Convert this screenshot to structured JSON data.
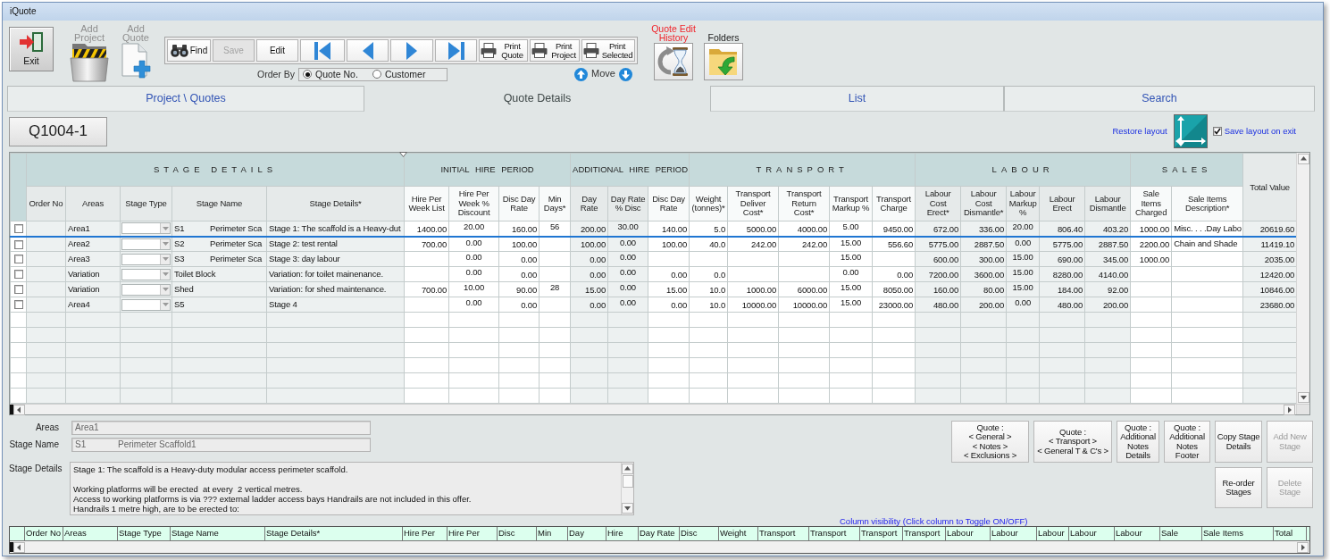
{
  "window": {
    "title": "iQuote"
  },
  "toolbar": {
    "exit": {
      "label": "Exit"
    },
    "add_project": {
      "label": "Add Project",
      "disabled": true
    },
    "add_quote": {
      "label": "Add Quote",
      "disabled": true
    },
    "buttons": [
      {
        "kind": "find",
        "label": "Find",
        "disabled": false
      },
      {
        "kind": "save",
        "label": "Save",
        "disabled": true
      },
      {
        "kind": "edit",
        "label": "Edit",
        "disabled": false
      },
      {
        "kind": "first",
        "disabled": false
      },
      {
        "kind": "previous",
        "disabled": false
      },
      {
        "kind": "next",
        "disabled": false
      },
      {
        "kind": "last",
        "disabled": false
      },
      {
        "kind": "print",
        "label": "Print Quote",
        "disabled": false
      },
      {
        "kind": "print",
        "label": "Print Project",
        "disabled": false
      },
      {
        "kind": "print",
        "label": "Print Selected",
        "disabled": false
      }
    ],
    "order_by": {
      "label": "Order By",
      "options": [
        {
          "label": "Quote No.",
          "selected": true
        },
        {
          "label": "Customer",
          "selected": false
        }
      ]
    },
    "move": {
      "label": "Move"
    },
    "edit_history": {
      "label": "Quote Edit History",
      "highlighted": true
    },
    "folders": {
      "label": "Folders"
    }
  },
  "tabs": [
    {
      "label": "Project \\ Quotes",
      "selected": false
    },
    {
      "label": "Quote Details",
      "selected": true
    },
    {
      "label": "List",
      "selected": false
    },
    {
      "label": "Search",
      "selected": false
    }
  ],
  "quote_number": "Q1004-1",
  "layout_controls": {
    "restore_label": "Restore layout",
    "save_on_exit": {
      "label": "Save layout on exit",
      "checked": true
    }
  },
  "grid": {
    "groups": [
      {
        "label": "STAGE DETAILS",
        "columns": [
          {
            "label": "Order No",
            "kind": "text",
            "shaded": true
          },
          {
            "label": "Areas",
            "kind": "text",
            "shaded": true
          },
          {
            "label": "Stage Type",
            "kind": "dropdown",
            "shaded": true
          },
          {
            "label": "Stage Name",
            "kind": "text",
            "shaded": true
          },
          {
            "label": "Stage Details*",
            "kind": "text",
            "shaded": true
          }
        ]
      },
      {
        "label": "INITIAL HIRE PERIOD",
        "columns": [
          {
            "label": "Hire Per Week List",
            "kind": "number",
            "shaded": false
          },
          {
            "label": "Hire Per Week % Discount",
            "kind": "rate",
            "shaded": false
          },
          {
            "label": "Disc Day Rate",
            "kind": "number",
            "shaded": false
          },
          {
            "label": "Min Days*",
            "kind": "rate",
            "shaded": false
          }
        ]
      },
      {
        "label": "ADDITIONAL HIRE PERIOD",
        "columns": [
          {
            "label": "Day Rate",
            "kind": "number",
            "shaded": true
          },
          {
            "label": "Day Rate % Disc",
            "kind": "rate",
            "shaded": true
          },
          {
            "label": "Disc Day Rate",
            "kind": "number",
            "shaded": false
          }
        ]
      },
      {
        "label": "TRANSPORT",
        "columns": [
          {
            "label": "Weight (tonnes)*",
            "kind": "number",
            "shaded": false
          },
          {
            "label": "Transport Deliver Cost*",
            "kind": "number",
            "shaded": false
          },
          {
            "label": "Transport Return Cost*",
            "kind": "number",
            "shaded": false
          },
          {
            "label": "Transport Markup %",
            "kind": "rate",
            "shaded": false
          },
          {
            "label": "Transport Charge",
            "kind": "number",
            "shaded": false
          }
        ]
      },
      {
        "label": "LABOUR",
        "columns": [
          {
            "label": "Labour Cost Erect*",
            "kind": "number",
            "shaded": true
          },
          {
            "label": "Labour Cost Dismantle*",
            "kind": "number",
            "shaded": true
          },
          {
            "label": "Labour Markup %",
            "kind": "rate",
            "shaded": true
          },
          {
            "label": "Labour Erect",
            "kind": "number",
            "shaded": true
          },
          {
            "label": "Labour Dismantle",
            "kind": "number",
            "shaded": true
          }
        ]
      },
      {
        "label": "SALES",
        "columns": [
          {
            "label": "Sale Items Charged",
            "kind": "number",
            "shaded": false
          },
          {
            "label": "Sale Items Description*",
            "kind": "text",
            "shaded": false
          }
        ]
      }
    ],
    "total_column": {
      "label": "Total Value",
      "kind": "number",
      "shaded": true
    },
    "rows": [
      {
        "checked": false,
        "selected": true,
        "cells": [
          null,
          "Area1",
          null,
          "S1\tPerimeter Sca",
          "Stage 1: The scaffold is a Heavy-dut",
          "1400.00",
          "20.00",
          "160.00",
          "56",
          "200.00",
          "30.00",
          "140.00",
          "5.0",
          "5000.00",
          "4000.00",
          "5.00",
          "9450.00",
          "672.00",
          "336.00",
          "20.00",
          "806.40",
          "403.20",
          "1000.00",
          "Misc. . . .Day Labo",
          "20619.60"
        ]
      },
      {
        "checked": false,
        "selected": false,
        "cells": [
          null,
          "Area2",
          null,
          "S2\tPerimeter Sca",
          "Stage 2: test rental",
          "700.00",
          "0.00",
          "100.00",
          null,
          "100.00",
          "0.00",
          "100.00",
          "40.0",
          "242.00",
          "242.00",
          "15.00",
          "556.60",
          "5775.00",
          "2887.50",
          "0.00",
          "5775.00",
          "2887.50",
          "2200.00",
          "Chain and Shade",
          "11419.10"
        ]
      },
      {
        "checked": false,
        "selected": false,
        "cells": [
          null,
          "Area3",
          null,
          "S3\tPerimeter Sca",
          "Stage 3: day labour",
          null,
          "0.00",
          "0.00",
          null,
          "0.00",
          "0.00",
          null,
          null,
          null,
          null,
          "15.00",
          null,
          "600.00",
          "300.00",
          "15.00",
          "690.00",
          "345.00",
          "1000.00",
          null,
          "2035.00"
        ]
      },
      {
        "checked": false,
        "selected": false,
        "cells": [
          null,
          "Variation",
          null,
          "Toilet Block",
          "Variation: for toilet mainenance.",
          null,
          "0.00",
          "0.00",
          null,
          "0.00",
          "0.00",
          "0.00",
          "0.0",
          null,
          null,
          "0.00",
          "0.00",
          "7200.00",
          "3600.00",
          "15.00",
          "8280.00",
          "4140.00",
          null,
          null,
          "12420.00"
        ]
      },
      {
        "checked": false,
        "selected": false,
        "cells": [
          null,
          "Variation",
          null,
          "Shed",
          "Variation: for shed maintenance.",
          "700.00",
          "10.00",
          "90.00",
          "28",
          "15.00",
          "0.00",
          "15.00",
          "10.0",
          "1000.00",
          "6000.00",
          "15.00",
          "8050.00",
          "160.00",
          "80.00",
          "15.00",
          "184.00",
          "92.00",
          null,
          null,
          "10846.00"
        ]
      },
      {
        "checked": false,
        "selected": false,
        "cells": [
          null,
          "Area4",
          null,
          "S5",
          "Stage 4",
          null,
          "0.00",
          "0.00",
          null,
          "0.00",
          "0.00",
          "0.00",
          "10.0",
          "10000.00",
          "10000.00",
          "15.00",
          "23000.00",
          "480.00",
          "200.00",
          "0.00",
          "480.00",
          "200.00",
          null,
          null,
          "23680.00"
        ]
      }
    ]
  },
  "details": {
    "areas": {
      "label": "Areas",
      "value": "Area1"
    },
    "stage_name": {
      "label": "Stage Name",
      "value": "S1\tPerimeter Scaffold1"
    },
    "stage_details": {
      "label": "Stage Details",
      "value": "Stage 1: The scaffold is a Heavy-duty modular access perimeter scaffold.\n\nWorking platforms will be erected  at every  2 vertical metres.\nAccess to working platforms is via ??? external ladder access bays Handrails are not included in this offer.\nHandrails 1 metre high, are to be erected to:"
    }
  },
  "action_rows": [
    {
      "buttons": [
        {
          "label": "Quote :\n< General >\n< Notes >\n< Exclusions >",
          "disabled": false
        },
        {
          "label": "Quote :\n< Transport >\n< General T & C's >",
          "disabled": false
        },
        {
          "label": "Quote :\nAdditional\nNotes\nDetails",
          "disabled": false
        },
        {
          "label": "Quote :\nAdditional\nNotes\nFooter",
          "disabled": false
        },
        {
          "label": "Copy Stage\nDetails",
          "disabled": false
        },
        {
          "label": "Add New\nStage",
          "disabled": true
        }
      ]
    },
    {
      "buttons": [
        {
          "label": "Re-order\nStages",
          "disabled": false
        },
        {
          "label": "Delete\nStage",
          "disabled": true
        }
      ]
    }
  ],
  "column_visibility": {
    "caption": "Column visibility (Click column to Toggle ON/OFF)",
    "columns": [
      "Order No",
      "Areas",
      "Stage Type",
      "Stage Name",
      "Stage Details*",
      "Hire Per",
      "Hire Per",
      "Disc",
      "Min",
      "Day",
      "Hire",
      "Day Rate",
      "Disc",
      "Weight",
      "Transport",
      "Transport",
      "Transport",
      "Transport",
      "Labour",
      "Labour",
      "Labour",
      "Labour",
      "Labour",
      "Sale",
      "Sale Items",
      "Total"
    ]
  }
}
